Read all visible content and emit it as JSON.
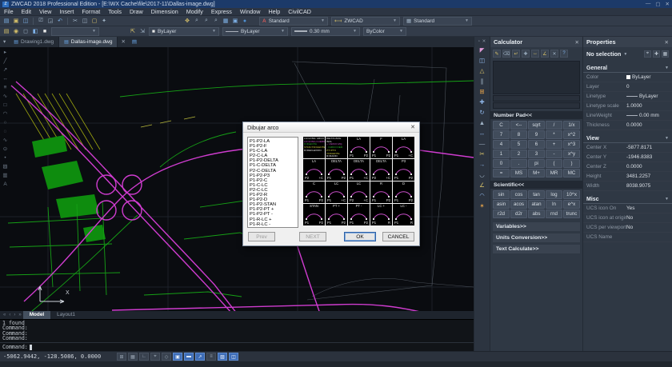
{
  "titlebar": {
    "title": "ZWCAD 2018 Professional Edition - [E:\\WX Cache\\file\\2017-11\\Dallas-image.dwg]",
    "minimize": "—",
    "maximize": "▢",
    "close": "✕"
  },
  "menubar": {
    "items": [
      "File",
      "Edit",
      "View",
      "Insert",
      "Format",
      "Tools",
      "Draw",
      "Dimension",
      "Modify",
      "Express",
      "Window",
      "Help",
      "CivilCAD"
    ]
  },
  "toolbar": {
    "text_style": "Standard",
    "dim_style": "ZWCAD",
    "table_style": "Standard",
    "color_control": "ByLayer",
    "linetype_control": "ByLayer",
    "lineweight_control": "0.30 mm",
    "plotstyle_control": "ByColor"
  },
  "doc_tabs": {
    "tabs": [
      {
        "label": "Drawing1.dwg"
      },
      {
        "label": "Dallas-image.dwg"
      }
    ],
    "active_index": 1,
    "close_glyph": "✕",
    "new_glyph": "▤"
  },
  "left_toolbar_icons": [
    {
      "name": "select-icon",
      "g": "▸"
    },
    {
      "name": "line-icon",
      "g": "╱"
    },
    {
      "name": "ray-icon",
      "g": "↗"
    },
    {
      "name": "xline-icon",
      "g": "↔"
    },
    {
      "name": "mline-icon",
      "g": "≡"
    },
    {
      "name": "polyline-icon",
      "g": "∿"
    },
    {
      "name": "rectangle-icon",
      "g": "□"
    },
    {
      "name": "arc-icon",
      "g": "◠"
    },
    {
      "name": "circle-icon",
      "g": "○"
    },
    {
      "name": "revcloud-icon",
      "g": "◌"
    },
    {
      "name": "spline-icon",
      "g": "∿"
    },
    {
      "name": "ellipse-icon",
      "g": "⊙"
    },
    {
      "name": "point-icon",
      "g": "•"
    },
    {
      "name": "hatch-icon",
      "g": "▨"
    },
    {
      "name": "region-icon",
      "g": "▥"
    },
    {
      "name": "text-icon",
      "g": "A"
    }
  ],
  "strip_icons": [
    {
      "name": "modify-erase-icon",
      "g": "◤",
      "c": "#e09ad8"
    },
    {
      "name": "modify-copy-icon",
      "g": "◫",
      "c": "#8fb6e8"
    },
    {
      "name": "modify-mirror-icon",
      "g": "△",
      "c": "#d8c26a"
    },
    {
      "name": "modify-offset-icon",
      "g": "∥",
      "c": "#9fb2c4"
    },
    {
      "name": "modify-array-icon",
      "g": "⊞",
      "c": "#e0a04a"
    },
    {
      "name": "modify-move-icon",
      "g": "✚",
      "c": "#8fb6e8"
    },
    {
      "name": "modify-rotate-icon",
      "g": "↻",
      "c": "#8fb6e8"
    },
    {
      "name": "modify-scale-icon",
      "g": "▲",
      "c": "#9fb2c4"
    },
    {
      "name": "modify-stretch-icon",
      "g": "↔",
      "c": "#8fb6e8"
    },
    {
      "name": "modify-lengthen-icon",
      "g": "—",
      "c": "#9fb2c4"
    },
    {
      "name": "modify-trim-icon",
      "g": "✂",
      "c": "#d8c26a"
    },
    {
      "name": "modify-extend-icon",
      "g": "→",
      "c": "#8fb6e8"
    },
    {
      "name": "modify-break-icon",
      "g": "◡",
      "c": "#9fb2c4"
    },
    {
      "name": "modify-chamfer-icon",
      "g": "∠",
      "c": "#d8c26a"
    },
    {
      "name": "modify-fillet-icon",
      "g": "◠",
      "c": "#8fb6e8"
    },
    {
      "name": "modify-explode-icon",
      "g": "✶",
      "c": "#e0a04a"
    }
  ],
  "dialog": {
    "title": "Dibujar arco",
    "close_glyph": "✕",
    "list": [
      "P1-P2-LA",
      "P1-P2-F",
      "P1-C-LA",
      "P2-C-LA",
      "P1-P2-DELTA",
      "P1-C-DELTA",
      "P2-C-DELTA",
      "P1-P2-P3",
      "P1-P2-C",
      "P1-C-LC",
      "P2-C-LC",
      "P1-P2-R",
      "P1-P2-D",
      "P1-P2-STAN",
      "P1-P2-PT +",
      "P1-P2-PT -",
      "P1-R-LC +",
      "P1-R-LC -"
    ],
    "legend1": {
      "lines": [
        {
          "t": "LA=LONG. ARCO",
          "c": "#e8e8e8"
        },
        {
          "t": "LC=LONG.CUERDA",
          "c": "#d259d2"
        },
        {
          "t": "F=FLECHA",
          "c": "#2fb52f"
        },
        {
          "t": "STAN=TANGENTE",
          "c": "#c9c93f"
        },
        {
          "t": "D=DEFLEXION",
          "c": "#e8e8e8"
        }
      ]
    },
    "legend2": {
      "lines": [
        {
          "t": "DELTA=ANG. INCL",
          "c": "#e8e8e8"
        },
        {
          "t": "+ =ARCO IZQ.",
          "c": "#d259d2"
        },
        {
          "t": "- =ARCO DER.",
          "c": "#2fb52f"
        },
        {
          "t": "PT=PTO TANGENTE",
          "c": "#c9c93f"
        },
        {
          "t": "R=RADIO",
          "c": "#e8e8e8"
        },
        {
          "t": "C=CENTRO",
          "c": "#d259d2"
        }
      ]
    },
    "thumbs": [
      {
        "legend": 1
      },
      {
        "legend": 2
      },
      {
        "tc": "LA",
        "bl": "P1",
        "br": "P2"
      },
      {
        "tc": "F",
        "bl": "P1",
        "br": "P2"
      },
      {
        "tc": "LA",
        "bl": "P1",
        "br": "+C"
      },
      {
        "tc": "LA",
        "bl": "P2",
        "br": "+C"
      },
      {
        "tc": "DELTA",
        "bl": "P1",
        "br": "P2"
      },
      {
        "tc": "DELTA",
        "bl": "P1",
        "br": "+C"
      },
      {
        "tc": "DELTA",
        "bl": "P2",
        "br": "+C"
      },
      {
        "tc": "P3",
        "bl": "P1",
        "br": "P2"
      },
      {
        "tc": "C",
        "bl": "P1",
        "br": "P2"
      },
      {
        "tc": "LC",
        "bl": "P1",
        "br": "+C"
      },
      {
        "tc": "LC",
        "bl": "P2",
        "br": "+C"
      },
      {
        "tc": "R",
        "bl": "P1",
        "br": "P2"
      },
      {
        "tc": "D",
        "bl": "P1",
        "br": "P2"
      },
      {
        "tc": "STAN",
        "bl": "P1",
        "br": "P2"
      },
      {
        "tc": "PT +",
        "bl": "P1",
        "br": "P2"
      },
      {
        "tc": "PT -",
        "bl": "P1",
        "br": "P2"
      },
      {
        "tc": "LC +",
        "bl": "P1",
        "br": "R"
      },
      {
        "tc": "LC -",
        "bl": "P1",
        "br": "R"
      }
    ],
    "buttons": {
      "prev": "Prev",
      "next": "NEXT",
      "ok": "OK",
      "cancel": "CANCEL"
    }
  },
  "calculator": {
    "title": "Calculator",
    "close_glyph": "✕",
    "tools": [
      {
        "name": "clear-icon",
        "g": "✎",
        "c": "#d8c26a"
      },
      {
        "name": "backspace-icon",
        "g": "⌫",
        "c": "#9fb2c4"
      },
      {
        "name": "paste-value-icon",
        "g": "↵",
        "c": "#d8c26a"
      },
      {
        "name": "get-coordinates-icon",
        "g": "✚",
        "c": "#9fb2c4"
      },
      {
        "name": "distance-icon",
        "g": "↔",
        "c": "#d8c26a"
      },
      {
        "name": "angle-icon",
        "g": "∠",
        "c": "#d8c26a"
      },
      {
        "name": "intersection-icon",
        "g": "✕",
        "c": "#9fb2c4"
      },
      {
        "name": "help-icon",
        "g": "?",
        "c": "#7fb2e8"
      }
    ],
    "numpad_header": "Number Pad<<",
    "numpad": [
      [
        "C",
        "<--",
        "sqrt",
        "/",
        "1/x"
      ],
      [
        "7",
        "8",
        "9",
        "*",
        "x^2"
      ],
      [
        "4",
        "5",
        "6",
        "+",
        "x^3"
      ],
      [
        "1",
        "2",
        "3",
        "-",
        "x^y"
      ],
      [
        "0",
        ".",
        "pi",
        "(",
        ")"
      ],
      [
        "=",
        "MS",
        "M+",
        "MR",
        "MC"
      ]
    ],
    "scientific_header": "Scientific<<",
    "scientific": [
      [
        "sin",
        "cos",
        "tan",
        "log",
        "10^x"
      ],
      [
        "asin",
        "acos",
        "atan",
        "ln",
        "e^x"
      ],
      [
        "r2d",
        "d2r",
        "abs",
        "rnd",
        "trunc"
      ]
    ],
    "sections": [
      "Variables>>",
      "Units Conversion>>",
      "Text Calculate>>"
    ]
  },
  "properties": {
    "title": "Properties",
    "close_glyph": "✕",
    "selection": "No selection",
    "general": {
      "header": "General",
      "rows": [
        {
          "label": "Color",
          "value": "ByLayer",
          "pre": "swatch"
        },
        {
          "label": "Layer",
          "value": "0"
        },
        {
          "label": "Linetype",
          "value": "ByLayer",
          "pre": "line"
        },
        {
          "label": "Linetype scale",
          "value": "1.0000"
        },
        {
          "label": "LineWeight",
          "value": "0.00 mm",
          "pre": "line"
        },
        {
          "label": "Thickness",
          "value": "0.0000"
        }
      ]
    },
    "view": {
      "header": "View",
      "rows": [
        {
          "label": "Center X",
          "value": "-5877.8171"
        },
        {
          "label": "Center Y",
          "value": "-1946.8383"
        },
        {
          "label": "Center Z",
          "value": "0.0000"
        },
        {
          "label": "Height",
          "value": "3481.2257"
        },
        {
          "label": "Width",
          "value": "8038.9075"
        }
      ]
    },
    "misc": {
      "header": "Misc",
      "rows": [
        {
          "label": "UCS icon On",
          "value": "Yes"
        },
        {
          "label": "UCS icon at origin",
          "value": "No"
        },
        {
          "label": "UCS per viewport",
          "value": "No"
        },
        {
          "label": "UCS Name",
          "value": ""
        }
      ]
    }
  },
  "model_tabs": {
    "nav": [
      "«",
      "‹",
      "›",
      "»"
    ],
    "tabs": [
      "Model",
      "Layout1"
    ],
    "active_index": 0
  },
  "command": {
    "history": [
      "1 found",
      "Command:",
      "Command:",
      "Command:"
    ],
    "prompt": "Command:"
  },
  "statusbar": {
    "coords": "-5062.9442, -128.5086, 0.0000",
    "toggles": [
      {
        "name": "snap-toggle",
        "g": "⊞",
        "active": false
      },
      {
        "name": "grid-toggle",
        "g": "▦",
        "active": false
      },
      {
        "name": "ortho-toggle",
        "g": "∟",
        "active": false
      },
      {
        "name": "polar-toggle",
        "g": "⌖",
        "active": false
      },
      {
        "name": "esnap-toggle",
        "g": "◇",
        "active": false
      },
      {
        "name": "etrack-toggle",
        "g": "▣",
        "active": true
      },
      {
        "name": "lineweight-toggle",
        "g": "▬",
        "active": true
      },
      {
        "name": "dyn-input-toggle",
        "g": "↗",
        "active": true
      },
      {
        "name": "transparency-toggle",
        "g": "≡",
        "active": false
      },
      {
        "name": "selection-cycling-toggle",
        "g": "▨",
        "active": true
      },
      {
        "name": "annotation-toggle",
        "g": "◫",
        "active": true
      }
    ]
  }
}
